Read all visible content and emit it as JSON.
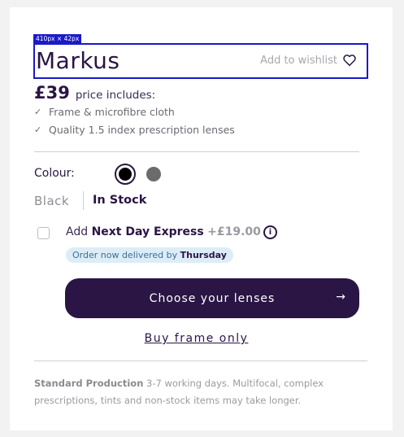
{
  "debug": {
    "size_tag": "410px × 42px"
  },
  "product": {
    "name": "Markus",
    "wishlist_label": "Add to wishlist",
    "price": "£39",
    "price_includes": "price includes:",
    "features": [
      "Frame & microfibre cloth",
      "Quality 1.5 index prescription lenses"
    ]
  },
  "colour": {
    "label": "Colour:",
    "options": [
      {
        "name": "Black",
        "hex": "#000000",
        "selected": true
      },
      {
        "name": "Grey",
        "hex": "#6b6b6b",
        "selected": false
      }
    ],
    "selected_name": "Black",
    "stock_status": "In Stock"
  },
  "express": {
    "checked": false,
    "prefix": "Add",
    "name": "Next Day Express",
    "price": "+£19.00",
    "info_icon": "info-icon",
    "delivery_text": "Order now delivered by",
    "delivery_day": "Thursday"
  },
  "actions": {
    "choose_lenses": "Choose your lenses",
    "choose_lenses_icon": "arrow-right-icon",
    "buy_frame_only": "Buy frame only"
  },
  "production": {
    "title": "Standard Production",
    "text": "3-7 working days. Multifocal, complex prescriptions, tints and non-stock items may take longer."
  },
  "colors": {
    "brand": "#2a1544",
    "highlight": "#1a1ac8",
    "pill_bg": "#dcedf7",
    "muted": "#9a9aa2"
  }
}
